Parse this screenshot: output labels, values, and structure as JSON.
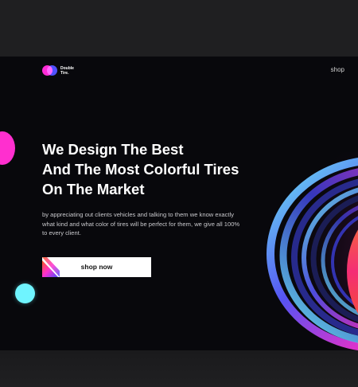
{
  "brand": {
    "line1": "Double",
    "line2": "Tire."
  },
  "nav": {
    "shop_label": "shop"
  },
  "hero": {
    "headline_lines": [
      "We Design The Best",
      "And The Most Colorful Tires",
      "On The Market"
    ],
    "description": "by appreciating out clients vehicles and talking to them we know exactly what kind and what color of tires will be perfect for them, we give all 100% to every client.",
    "cta_label": "shop now"
  },
  "colors": {
    "hero_bg": "#08080c",
    "accent_pink": "#ff2fcf",
    "accent_cyan": "#6ff4ff",
    "accent_blue": "#4a4bff",
    "accent_orange": "#ff5a1f"
  },
  "icons": [
    "double-circle-logo-icon",
    "colorful-tire-illustration"
  ]
}
